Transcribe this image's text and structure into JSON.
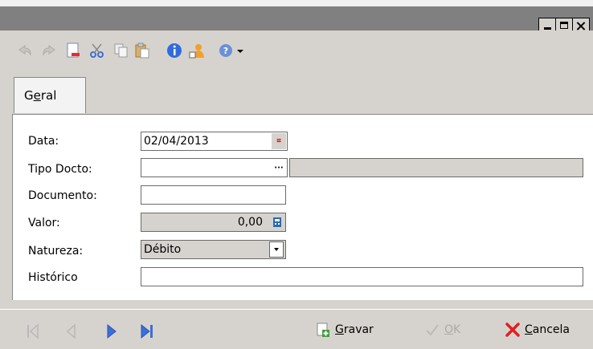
{
  "tab": {
    "label_pre": "G",
    "label_ul": "e",
    "label_post": "ral"
  },
  "form": {
    "data_label": "Data:",
    "data_value": "02/04/2013",
    "tipo_label": "Tipo Docto:",
    "tipo_button": "···",
    "documento_label": "Documento:",
    "valor_label": "Valor:",
    "valor_value": "0,00",
    "natureza_label": "Natureza:",
    "natureza_value": "Débito",
    "historico_label": "Histórico"
  },
  "actions": {
    "gravar_ul": "G",
    "gravar_rest": "ravar",
    "ok_ul": "O",
    "ok_rest": "K",
    "cancela_ul": "C",
    "cancela_rest": "ancela"
  },
  "colors": {
    "bg": "#d6d3ce",
    "title": "#808080",
    "nav": "#3a6fd8",
    "cancel": "#d22"
  }
}
